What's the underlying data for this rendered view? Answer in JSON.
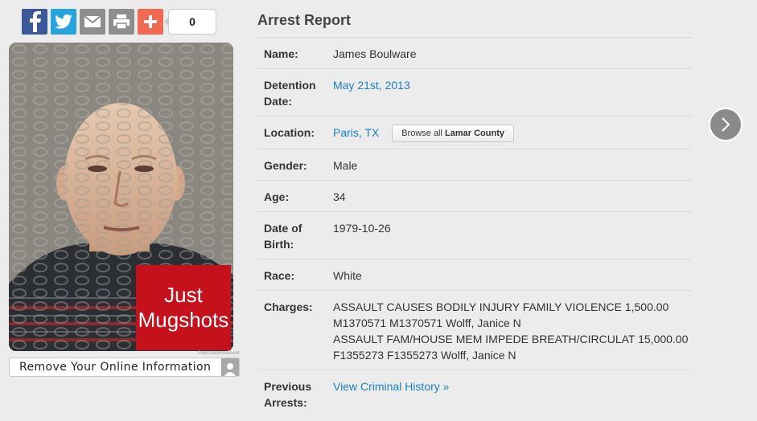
{
  "share": {
    "buttons": [
      {
        "name": "facebook-icon"
      },
      {
        "name": "twitter-icon"
      },
      {
        "name": "email-icon"
      },
      {
        "name": "print-icon"
      },
      {
        "name": "plus-icon"
      }
    ],
    "count": "0"
  },
  "ad": {
    "line1": "Just",
    "line2": "Mugshots",
    "paid_label": "Paid Advertisement"
  },
  "remove_info": {
    "label": "Remove Your Online Information"
  },
  "report": {
    "title": "Arrest Report",
    "rows": [
      {
        "label": "Name:",
        "value": "James Boulware"
      },
      {
        "label": "Detention Date:",
        "value": "May 21st, 2013"
      },
      {
        "label": "Location:",
        "value": "Paris, TX",
        "button_prefix": "Browse all",
        "button_bold": "Lamar County"
      },
      {
        "label": "Gender:",
        "value": "Male"
      },
      {
        "label": "Age:",
        "value": "34"
      },
      {
        "label": "Date of Birth:",
        "value": "1979-10-26"
      },
      {
        "label": "Race:",
        "value": "White"
      },
      {
        "label": "Charges:",
        "value_lines": [
          "ASSAULT CAUSES BODILY INJURY FAMILY VIOLENCE 1,500.00 M1370571 M1370571 Wolff, Janice N",
          "ASSAULT FAM/HOUSE MEM IMPEDE BREATH/CIRCULAT 15,000.00 F1355273 F1355273 Wolff, Janice N"
        ]
      },
      {
        "label": "Previous Arrests:",
        "value": "View Criminal History »"
      }
    ]
  },
  "colors": {
    "link": "#1a7fc1",
    "ad_red": "#c4111b",
    "facebook": "#3b5998",
    "twitter": "#27a3dd",
    "plus": "#f2694f"
  }
}
